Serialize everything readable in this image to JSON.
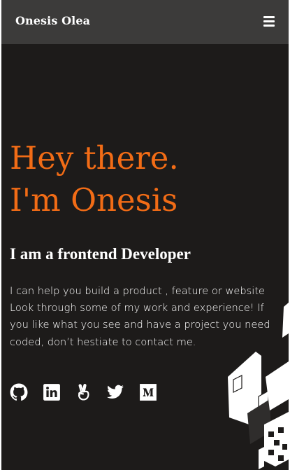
{
  "nav": {
    "brand": "Onesis Olea",
    "menu_icon": "hamburger-menu-icon"
  },
  "hero": {
    "title_line1": "Hey there.",
    "title_line2": "I'm Onesis",
    "subtitle": "I am a frontend Developer",
    "intro": "I can help you build a product , feature or website Look through some of my work and experience! If you like what you see and have a project you need coded, don’t hestiate to contact me."
  },
  "socials": [
    {
      "icon": "github-icon"
    },
    {
      "icon": "linkedin-icon"
    },
    {
      "icon": "angellist-icon"
    },
    {
      "icon": "twitter-icon"
    },
    {
      "icon": "medium-icon"
    }
  ],
  "colors": {
    "background": "#1d1b1a",
    "navbar": "#3c3b3a",
    "accent": "#f26c16",
    "text": "#ffffff"
  }
}
